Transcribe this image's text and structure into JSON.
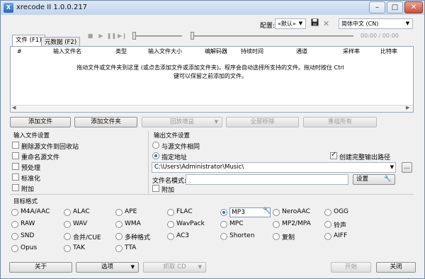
{
  "window": {
    "title": "xrecode II 1.0.0.217",
    "icon": "app-icon",
    "minimize": "–",
    "maximize": "□",
    "close": "✕"
  },
  "toolbar": {
    "config_label": "配置:",
    "config_value": "«默认»",
    "save_icon": "floppy-icon",
    "clear_icon": "close-icon",
    "language_value": "简体中文 (CN)",
    "time": "00:00 / 00:00"
  },
  "tabs": [
    {
      "label": "文件 (F1)"
    },
    {
      "label": "元数据 (F2)"
    }
  ],
  "table": {
    "columns": [
      "#",
      "输入文件名",
      "类型",
      "输入文件大小",
      "编解码器",
      "持续时间",
      "通道",
      "采样率",
      "比特率"
    ],
    "hint_line1": "拖动文件或文件夹到这里 (或点击添加文件或添加文件夹)。程序会自动选择所支持的文件。拖动时按住 Ctrl",
    "hint_line2": "键可以保留之前添加的文件。"
  },
  "actions": {
    "add_files": "添加文件",
    "add_folder": "添加文件夹",
    "replay_gain": "回放增益",
    "remove_all": "全部移除",
    "reset_all": "重组所有"
  },
  "input_settings": {
    "title": "输入文件设置",
    "options": [
      {
        "label": "删除源文件到回收站",
        "checked": false
      },
      {
        "label": "重命名源文件",
        "checked": false
      },
      {
        "label": "预处理",
        "checked": false
      },
      {
        "label": "标准化",
        "checked": false
      },
      {
        "label": "附加",
        "checked": false
      }
    ]
  },
  "output_settings": {
    "title": "输出文件设置",
    "same_as_source": "与源文件相同",
    "specified_path": "指定地址",
    "create_full_path": "创建完整输出路径",
    "path_value": "C:\\Users\\Administrator\\Music\\",
    "browse": "...",
    "filename_label": "文件名模式:",
    "settings_button": "设置",
    "append_label": "附加"
  },
  "formats": {
    "title": "目标格式",
    "selected": "MP3",
    "items": [
      "M4A/AAC",
      "ALAC",
      "APE",
      "FLAC",
      "MP3",
      "NeroAAC",
      "OGG",
      "RAW",
      "WAV",
      "WMA",
      "WavPack",
      "MPC",
      "MP2/MPA",
      "铃声",
      "SND",
      "合并/CUE",
      "多种格式",
      "AC3",
      "Shorten",
      "复制",
      "AIFF",
      "Opus",
      "TAK",
      "TTA"
    ]
  },
  "footer": {
    "about": "关于",
    "options": "选项",
    "grab_cd": "抓取 CD",
    "start": "开始",
    "close": "关闭"
  }
}
